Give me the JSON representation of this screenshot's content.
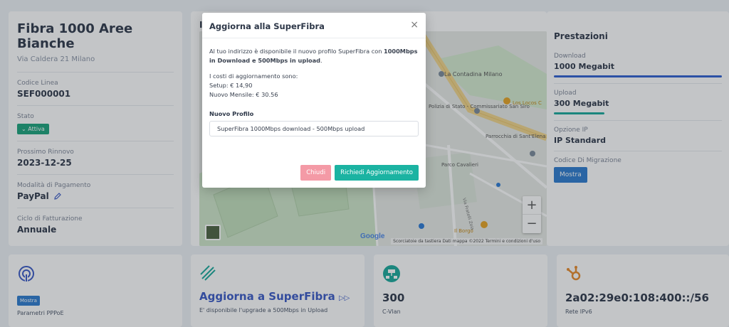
{
  "line": {
    "title": "Fibra 1000 Aree Bianche",
    "address": "Via Caldera 21 Milano",
    "fields": [
      {
        "label": "Codice Linea",
        "value": "SEF000001"
      },
      {
        "label": "Stato",
        "value": "Attiva"
      },
      {
        "label": "Prossimo Rinnovo",
        "value": "2023-12-25"
      },
      {
        "label": "Modalità di Pagamento",
        "value": "PayPal"
      },
      {
        "label": "Ciclo di Fatturazione",
        "value": "Annuale"
      }
    ]
  },
  "map": {
    "title_initial": "I",
    "labels": {
      "contadina": "La Contadina Milano",
      "polizia": "Polizia di Stato - Commissariato San Siro",
      "locos": "Los Locos C",
      "parrocchia": "Parrocchia di Sant'Elena - Oratorio",
      "parco": "Parco Cavalieri",
      "borgo": "Il Borgo",
      "via": "Via Fratelli Zoia"
    },
    "google": "Google",
    "footer": "Scorciatoie da tastiera   Dati mappa ©2022   Termini e condizioni d'uso",
    "zoom_in": "+",
    "zoom_out": "−"
  },
  "performance": {
    "title": "Prestazioni",
    "download": {
      "label": "Download",
      "value": "1000 Megabit",
      "fill": 1.0,
      "color": "#2f5fd0"
    },
    "upload": {
      "label": "Upload",
      "value": "300 Megabit",
      "fill": 0.3,
      "color": "#18a89a"
    },
    "ip": {
      "label": "Opzione IP",
      "value": "IP Standard"
    },
    "migration": {
      "label": "Codice Di Migrazione",
      "button": "Mostra"
    }
  },
  "bottom": {
    "pppoe": {
      "button": "Mostra",
      "label": "Parametri PPPoE"
    },
    "upgrade": {
      "title": "Aggiorna a SuperFibra",
      "sub": "E' disponibile l'upgrade a 500Mbps in Upload"
    },
    "cvlan": {
      "value": "300",
      "label": "C-Vlan"
    },
    "ipv6": {
      "value": "2a02:29e0:108:400::/56",
      "label": "Rete IPv6"
    }
  },
  "modal": {
    "title": "Aggiorna alla SuperFibra",
    "close": "×",
    "intro_pre": "Al tuo indirizzo è disponibile il nuovo profilo SuperFibra con ",
    "intro_bold": "1000Mbps in Download e 500Mbps in upload",
    "intro_post": ".",
    "costs_title": "I costi di aggiornamento sono:",
    "setup": "Setup: € 14,90",
    "monthly": "Nuovo Mensile: € 30.56",
    "profile_label": "Nuovo Profilo",
    "profile_value": "SuperFibra 1000Mbps download - 500Mbps upload",
    "btn_close": "Chiudi",
    "btn_request": "Richiedi Aggiornamento"
  }
}
